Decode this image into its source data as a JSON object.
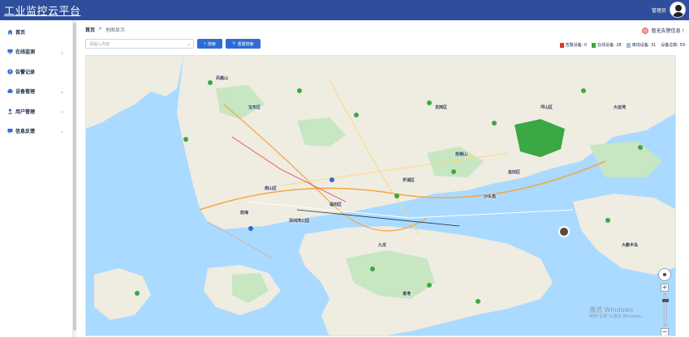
{
  "header": {
    "title": "工业监控云平台",
    "user_name": "管理员"
  },
  "sidebar": {
    "items": [
      {
        "label": "首页",
        "icon": "home-icon",
        "color": "#2e6bd6",
        "has_submenu": false
      },
      {
        "label": "在线监测",
        "icon": "monitor-icon",
        "color": "#2e6bd6",
        "has_submenu": true
      },
      {
        "label": "告警记录",
        "icon": "alarm-icon",
        "color": "#2e6bd6",
        "has_submenu": false
      },
      {
        "label": "设备管理",
        "icon": "device-icon",
        "color": "#2e6bd6",
        "has_submenu": true
      },
      {
        "label": "用户管理",
        "icon": "user-icon",
        "color": "#2e6bd6",
        "has_submenu": true
      },
      {
        "label": "信息反馈",
        "icon": "feedback-icon",
        "color": "#2e6bd6",
        "has_submenu": true
      }
    ]
  },
  "breadcrumb": {
    "home": "首页",
    "separator": ">",
    "current": "地图显示"
  },
  "alarm": {
    "text": "暂无告警信息 !"
  },
  "search": {
    "placeholder": "请输入内容",
    "button_label": "搜索",
    "reset_label": "重置搜索"
  },
  "legend": {
    "items": [
      {
        "label": "告警设备: 0",
        "color": "#d9342b"
      },
      {
        "label": "在线设备: 28",
        "color": "#3aa845"
      },
      {
        "label": "离线设备: 31",
        "color": "#9dbbe8"
      },
      {
        "label": "设备总数: 59",
        "color": null
      }
    ]
  },
  "map": {
    "labels": [
      "凤凰山",
      "大亚湾",
      "深圳湾公园",
      "福田区",
      "罗湖区",
      "南山区",
      "龙岗区",
      "坪山区",
      "香港",
      "九龙",
      "大鹏半岛",
      "梧桐山",
      "盐田区",
      "宝安区",
      "前海",
      "沙头角"
    ],
    "watermark_line1": "激活 Windows",
    "watermark_line2": "转到\"设置\"以激活 Windows。"
  }
}
